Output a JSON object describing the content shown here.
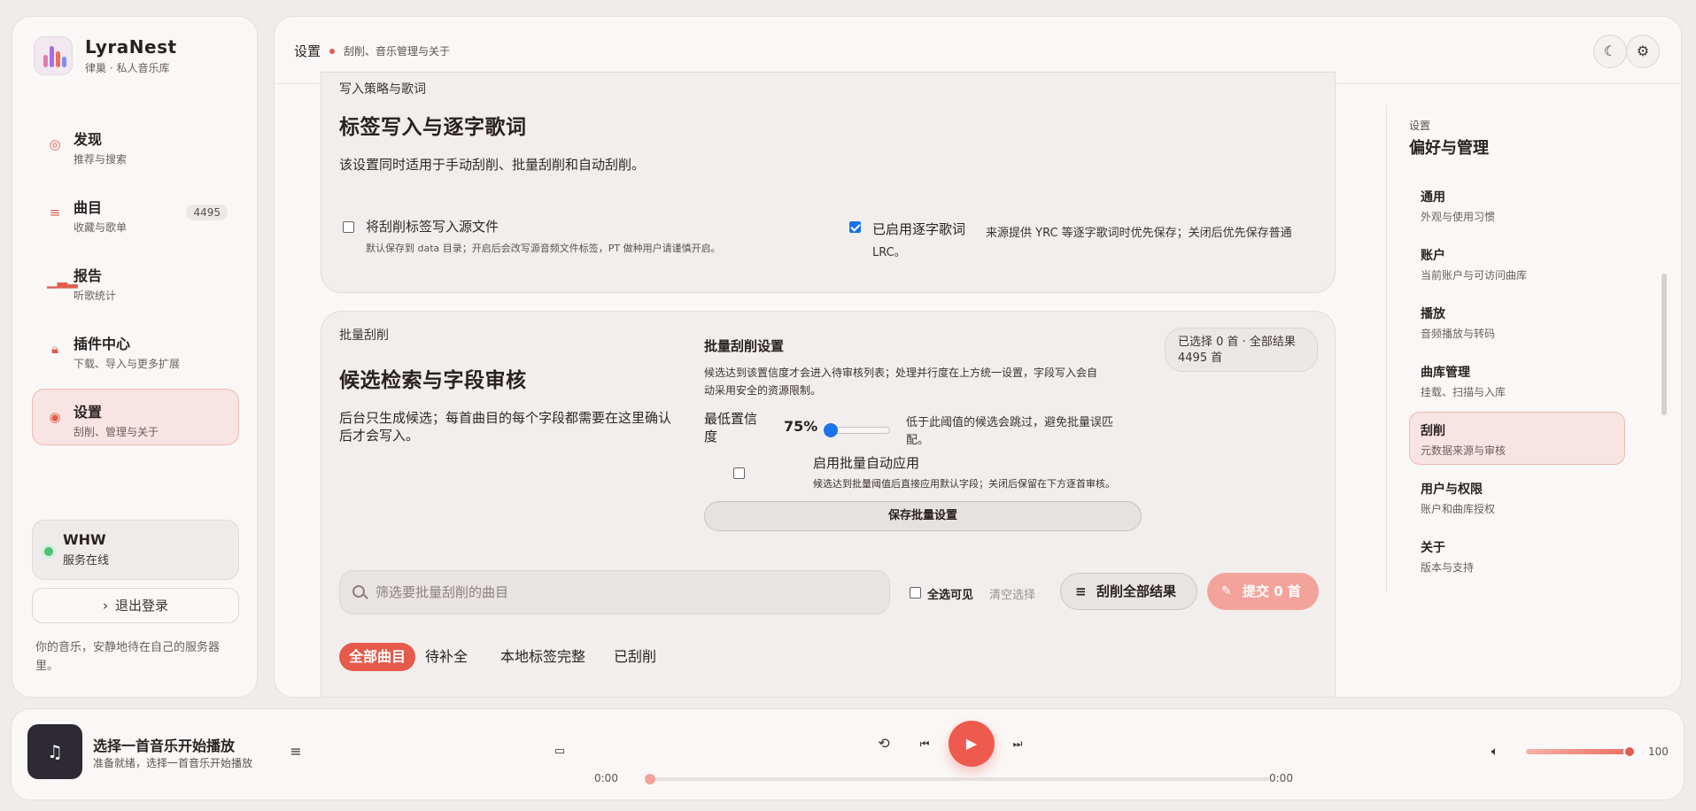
{
  "brand": {
    "name": "LyraNest",
    "subtitle": "律巢 · 私人音乐库"
  },
  "nav": [
    {
      "title": "发现",
      "sub": "推荐与搜索",
      "icon": "compass-icon"
    },
    {
      "title": "曲目",
      "sub": "收藏与歌单",
      "icon": "list-icon",
      "badge": "4495"
    },
    {
      "title": "报告",
      "sub": "听歌统计",
      "icon": "bar-chart-icon"
    },
    {
      "title": "插件中心",
      "sub": "下载、导入与更多扩展",
      "icon": "lock-icon"
    },
    {
      "title": "设置",
      "sub": "刮削、管理与关于",
      "icon": "settings-icon",
      "active": true
    }
  ],
  "user": {
    "name": "WHW",
    "status": "服务在线"
  },
  "logout_label": "退出登录",
  "sidebar_footer": "你的音乐，安静地待在自己的服务器里。",
  "header": {
    "title": "设置",
    "subtitle": "刮削、音乐管理与关于"
  },
  "card1": {
    "eyebrow": "写入策略与歌词",
    "title": "标签写入与逐字歌词",
    "desc": "该设置同时适用于手动刮削、批量刮削和自动刮削。",
    "opt1_label": "将刮削标签写入源文件",
    "opt1_hint": "默认保存到 data 目录；开启后会改写源音频文件标签，PT 做种用户请谨慎开启。",
    "opt1_checked": false,
    "opt2_label": "已启用逐字歌词",
    "opt2_hint_line1": "来源提供 YRC 等逐字歌词时优先保存；关闭后优先保存普通",
    "opt2_hint_line2": "LRC。",
    "opt2_checked": true
  },
  "card2": {
    "eyebrow": "批量刮削",
    "title": "候选检索与字段审核",
    "desc": "后台只生成候选；每首曲目的每个字段都需要在这里确认后才会写入。",
    "settings_title": "批量刮削设置",
    "settings_desc_line1": "候选达到该置信度才会进入待审核列表；处理并行度在上方统一设置，字段写入会自",
    "settings_desc_line2": "动采用安全的资源限制。",
    "confidence_label_1": "最低置信",
    "confidence_label_2": "度",
    "confidence_value": "75%",
    "confidence_fraction": 0.75,
    "confidence_hint_1": "低于此阈值的候选会跳过，避免批量误匹",
    "confidence_hint_2": "配。",
    "auto_apply_label": "启用批量自动应用",
    "auto_apply_hint": "候选达到批量阈值后直接应用默认字段；关闭后保留在下方逐首审核。",
    "auto_apply_checked": false,
    "save_button": "保存批量设置",
    "selection_line1": "已选择 0 首 · 全部结果",
    "selection_line2": "4495 首",
    "search_placeholder": "筛选要批量刮削的曲目",
    "select_all_label": "全选可见",
    "clear_label": "清空选择",
    "scrape_all_button": "刮削全部结果",
    "submit_button": "提交 0 首",
    "tabs": [
      "全部曲目",
      "待补全",
      "本地标签完整",
      "已刮削"
    ]
  },
  "toc": {
    "kicker": "设置",
    "title": "偏好与管理",
    "items": [
      {
        "title": "通用",
        "sub": "外观与使用习惯"
      },
      {
        "title": "账户",
        "sub": "当前账户与可访问曲库"
      },
      {
        "title": "播放",
        "sub": "音频播放与转码"
      },
      {
        "title": "曲库管理",
        "sub": "挂载、扫描与入库"
      },
      {
        "title": "刮削",
        "sub": "元数据来源与审核",
        "active": true
      },
      {
        "title": "用户与权限",
        "sub": "账户和曲库授权"
      },
      {
        "title": "关于",
        "sub": "版本与支持"
      }
    ]
  },
  "player": {
    "title": "选择一首音乐开始播放",
    "subtitle": "准备就绪，选择一首音乐开始播放",
    "time_current": "0:00",
    "time_total": "0:00",
    "progress_fraction": 0,
    "volume": "100"
  },
  "colors": {
    "accent": "#e55a4b",
    "accent_soft": "#f8e4e2",
    "online": "#4fbf75"
  }
}
